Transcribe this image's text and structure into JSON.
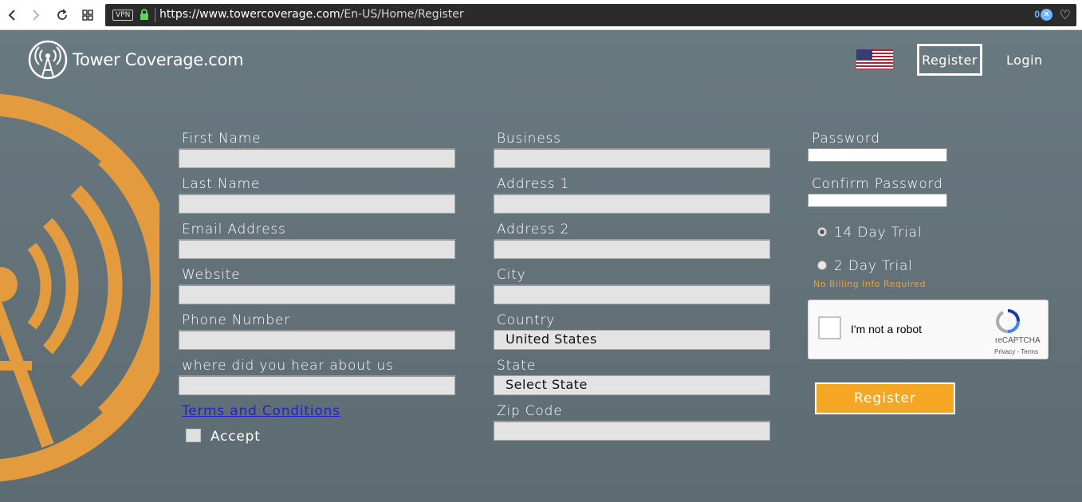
{
  "browser": {
    "vpn_label": "VPN",
    "url_domain": "https://www.towercoverage.com",
    "url_path": "/En-US/Home/Register",
    "blocked_count": "0",
    "shield_glyph": "×"
  },
  "header": {
    "logo_text": "Tower Coverage.com",
    "register_label": "Register",
    "login_label": "Login"
  },
  "form": {
    "col1": {
      "first_name": "First Name",
      "last_name": "Last Name",
      "email": "Email Address",
      "website": "Website",
      "phone": "Phone Number",
      "hear": "where did you hear about us",
      "terms": "Terms and Conditions",
      "accept": "Accept"
    },
    "col2": {
      "business": "Business",
      "address1": "Address 1",
      "address2": "Address 2",
      "city": "City",
      "country": "Country",
      "country_value": "United States",
      "state": "State",
      "state_value": "Select State",
      "zip": "Zip Code"
    },
    "col3": {
      "password": "Password",
      "confirm_password": "Confirm Password",
      "trial14": "14 Day Trial",
      "trial2": "2 Day Trial",
      "no_billing": "No Billing Info Required",
      "submit": "Register"
    },
    "recaptcha": {
      "label": "I'm not a robot",
      "brand": "reCAPTCHA",
      "links": "Privacy - Terms"
    }
  },
  "colors": {
    "accent": "#f5a623",
    "background": "#5f6d74",
    "link": "#2222cc"
  }
}
